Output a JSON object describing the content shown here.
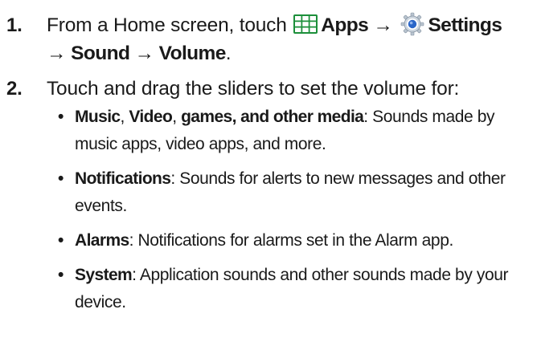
{
  "steps": [
    {
      "number": "1.",
      "prefix": "From a Home screen, touch ",
      "apps_label": "Apps",
      "arrow1": " → ",
      "settings_label": "Settings",
      "arrow2": "→ ",
      "sound_label": "Sound",
      "arrow3": " → ",
      "volume_label": "Volume",
      "end": "."
    },
    {
      "number": "2.",
      "text": "Touch and drag the sliders to set the volume for:"
    }
  ],
  "bullets": [
    {
      "bullet": "•",
      "b1": "Music",
      "sep1": ", ",
      "b2": "Video",
      "sep2": ", ",
      "b3": "games, and other media",
      "desc": ": Sounds made by music apps, video apps, and more."
    },
    {
      "bullet": "•",
      "term": "Notifications",
      "desc": ": Sounds for alerts to new messages and other events."
    },
    {
      "bullet": "•",
      "term": "Alarms",
      "desc": ": Notifications for alarms set in the Alarm app."
    },
    {
      "bullet": "•",
      "term": "System",
      "desc": ": Application sounds and other sounds made by your device."
    }
  ],
  "icons": {
    "apps": "apps-grid-icon",
    "settings": "settings-gear-icon"
  },
  "colors": {
    "text": "#1a1a1a",
    "apps_icon_tile": "#1c8f3a",
    "settings_icon_blue": "#2a66c8"
  }
}
